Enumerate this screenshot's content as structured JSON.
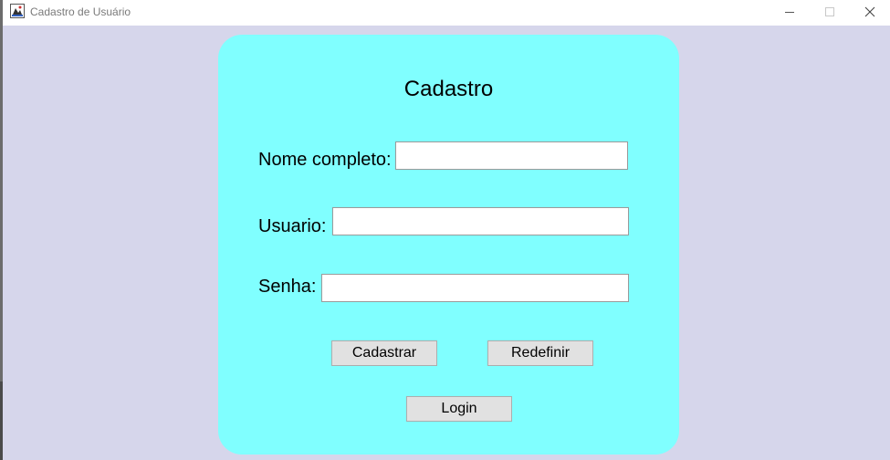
{
  "window": {
    "title": "Cadastro de Usuário"
  },
  "form": {
    "title": "Cadastro",
    "fields": {
      "nome": {
        "label": "Nome completo:",
        "value": ""
      },
      "usuario": {
        "label": "Usuario:",
        "value": ""
      },
      "senha": {
        "label": "Senha:",
        "value": ""
      }
    },
    "buttons": {
      "cadastrar": "Cadastrar",
      "redefinir": "Redefinir",
      "login": "Login"
    }
  },
  "colors": {
    "background": "#d6d6eb",
    "panel": "#80ffff",
    "button": "#e1e1e1"
  },
  "icons": {
    "app": "java-app-icon",
    "minimize": "minimize-icon",
    "maximize": "maximize-icon",
    "close": "close-icon"
  }
}
